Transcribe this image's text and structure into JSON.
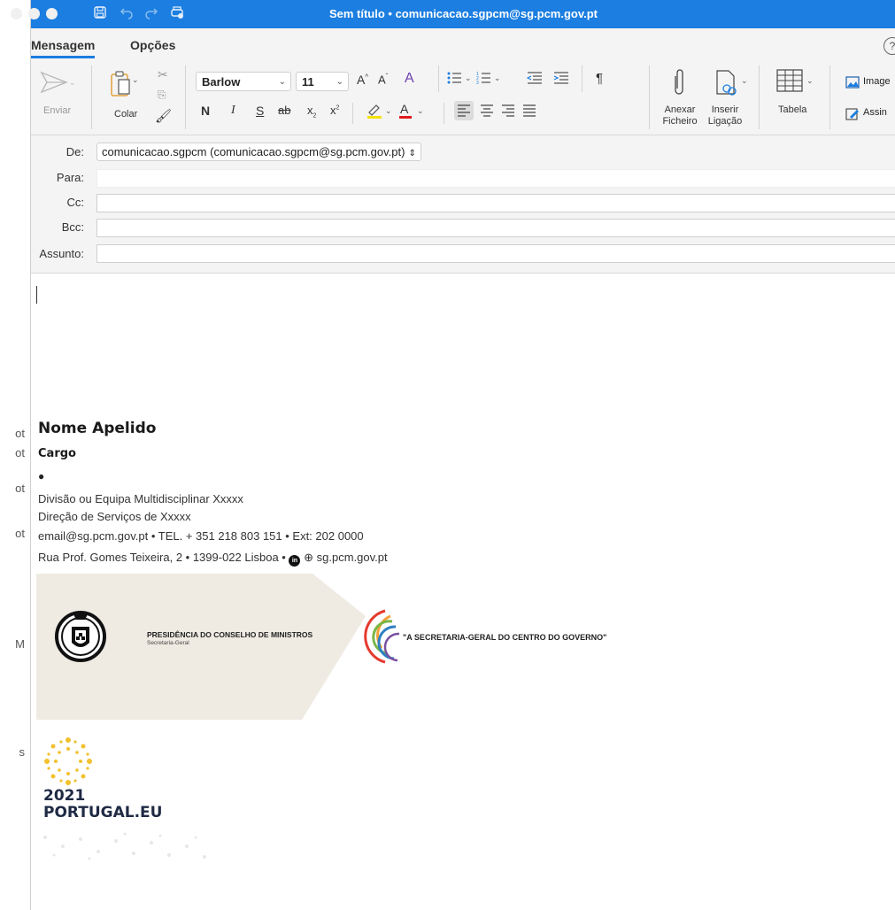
{
  "window": {
    "title": "Sem título • comunicacao.sgpcm@sg.pcm.gov.pt"
  },
  "background_strip": [
    "ot",
    "ot",
    "ot",
    "ot",
    "M",
    "s"
  ],
  "tabs": [
    {
      "label": "Mensagem",
      "active": true
    },
    {
      "label": "Opções",
      "active": false
    }
  ],
  "ribbon": {
    "send_label": "Enviar",
    "paste_label": "Colar",
    "font_name": "Barlow",
    "font_size": "11",
    "attach_label_1": "Anexar",
    "attach_label_2": "Ficheiro",
    "link_label_1": "Inserir",
    "link_label_2": "Ligação",
    "table_label": "Tabela",
    "image_label": "Image",
    "signature_label": "Assin"
  },
  "fields": {
    "from_label": "De:",
    "from_value": "comunicacao.sgpcm (comunicacao.sgpcm@sg.pcm.gov.pt)",
    "to_label": "Para:",
    "cc_label": "Cc:",
    "bcc_label": "Bcc:",
    "subject_label": "Assunto:"
  },
  "signature": {
    "name": "Nome Apelido",
    "title": "Cargo",
    "bullet": "●",
    "division": "Divisão ou Equipa Multidisciplinar Xxxxx",
    "directorate": "Direção de Serviços de Xxxxx",
    "contact_line": "email@sg.pcm.gov.pt  •  TEL. + 351 218 803 151  •  Ext: 202 0000",
    "address_line": "Rua Prof. Gomes Teixeira, 2  •  1399-022 Lisboa  •",
    "website": "sg.pcm.gov.pt",
    "org_name": "PRESIDÊNCIA DO CONSELHO DE MINISTROS",
    "org_sub": "Secretaria-Geral",
    "slogan": "\"A SECRETARIA-GERAL DO CENTRO DO GOVERNO\"",
    "pt_year": "2021",
    "pt_site": "PORTUGAL.EU"
  },
  "colors": {
    "titlebar": "#1b7ee0",
    "highlighter": "#f5e000",
    "font_color": "#e11b1b",
    "logo_yellow": "#f2c12e"
  }
}
